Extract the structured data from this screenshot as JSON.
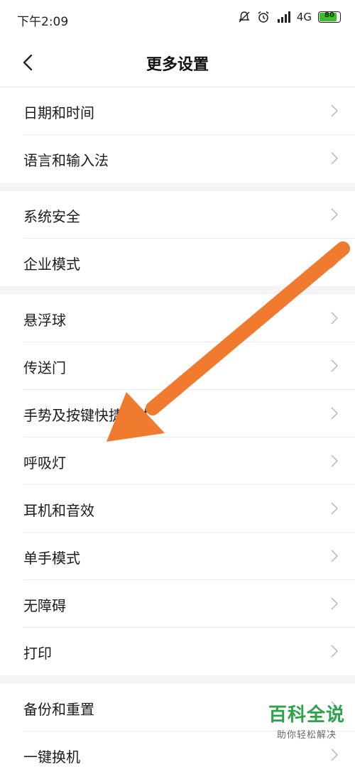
{
  "status_bar": {
    "time": "下午2:09",
    "network": "4G",
    "battery": "80",
    "battery_level": 0.8,
    "icons": [
      "mute-icon",
      "alarm-icon",
      "signal-icon",
      "battery-icon"
    ]
  },
  "nav": {
    "title": "更多设置",
    "back_icon": "chevron-left-icon"
  },
  "groups": [
    {
      "items": [
        {
          "label": "日期和时间"
        },
        {
          "label": "语言和输入法"
        }
      ]
    },
    {
      "items": [
        {
          "label": "系统安全"
        },
        {
          "label": "企业模式"
        }
      ]
    },
    {
      "items": [
        {
          "label": "悬浮球"
        },
        {
          "label": "传送门"
        },
        {
          "label": "手势及按键快捷方式"
        },
        {
          "label": "呼吸灯"
        },
        {
          "label": "耳机和音效"
        },
        {
          "label": "单手模式"
        },
        {
          "label": "无障碍"
        },
        {
          "label": "打印"
        }
      ]
    },
    {
      "items": [
        {
          "label": "备份和重置"
        },
        {
          "label": "一键换机"
        }
      ]
    }
  ],
  "annotation": {
    "arrow_color": "#f07a2e"
  },
  "watermark": {
    "title": "百科全说",
    "subtitle": "助你轻松解决"
  }
}
